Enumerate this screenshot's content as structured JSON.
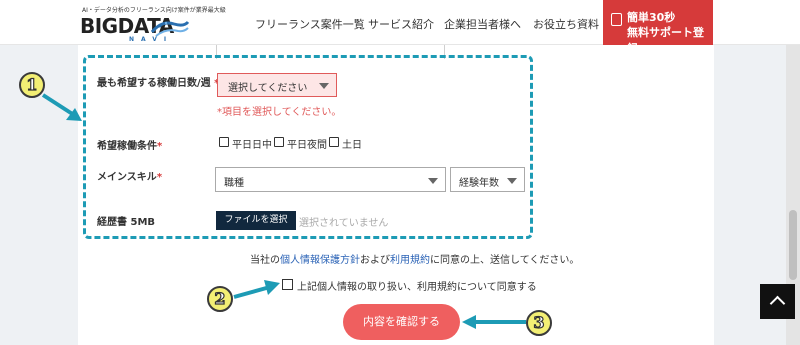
{
  "header": {
    "tagline": "AI・データ分析のフリーランス向け案件が業界最大級",
    "logo_text": "BIGDATA",
    "logo_sub": "NAVI",
    "nav_items": [
      "フリーランス案件一覧",
      "サービス紹介",
      "企業担当者様へ",
      "お役立ち資料"
    ],
    "cta_line1": "簡単30秒",
    "cta_line2": "無料サポート登録"
  },
  "form": {
    "workdays_label": "最も希望する稼働日数/週",
    "required_mark": "*",
    "workdays_select": "選択してください",
    "workdays_error": "*項目を選択してください。",
    "conditions_label": "希望稼働条件",
    "conditions_options": [
      "平日日中",
      "平日夜間",
      "土日"
    ],
    "skill_label": "メインスキル",
    "skill_select": "職種",
    "years_select": "経験年数",
    "resume_label": "経歴書 5MB",
    "file_button": "ファイルを選択",
    "file_status": "選択されていません"
  },
  "consent": {
    "prefix": "当社の",
    "privacy_link": "個人情報保護方針",
    "middle": "および",
    "terms_link": "利用規約",
    "suffix": "に同意の上、送信してください。",
    "agree_text": "上記個人情報の取り扱い、利用規約について同意する"
  },
  "submit_label": "内容を確認する",
  "annotations": {
    "b1": "1",
    "b2": "2",
    "b3": "3"
  },
  "colors": {
    "annotation": "#1d9bb5",
    "cta": "#d63a3a",
    "submit": "#ef5f5f",
    "error": "#e05a5a",
    "link": "#2b63b6"
  }
}
